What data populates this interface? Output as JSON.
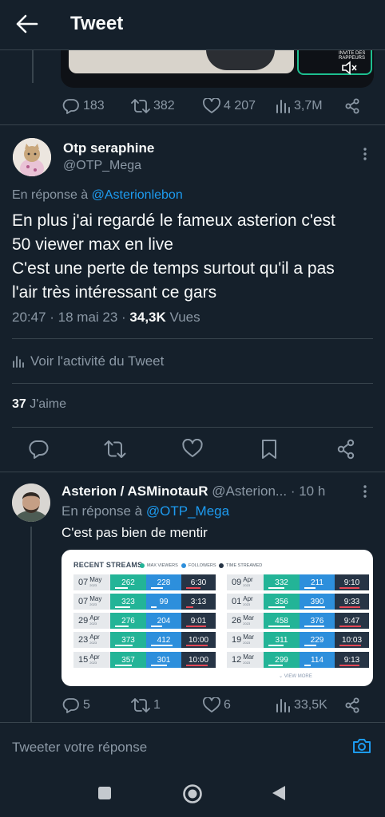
{
  "header": {
    "title": "Tweet"
  },
  "prev_tweet": {
    "media_label": "INVITE DES RAPPEURS",
    "stats": {
      "replies": "183",
      "retweets": "382",
      "likes": "4 207",
      "views": "3,7M"
    }
  },
  "main_tweet": {
    "name": "Otp seraphine",
    "handle": "@OTP_Mega",
    "reply_prefix": "En réponse à",
    "reply_to": "@Asterionlebon",
    "lines": [
      "En plus j'ai regardé le fameux asterion c'est",
      "50 viewer max en live",
      "C'est une perte de temps surtout qu'il a pas",
      "l'air très intéressant ce gars"
    ],
    "time": "20:47 · 18 mai 23 · ",
    "views_count": "34,3K",
    "views_label": " Vues",
    "activity": "Voir l'activité du Tweet",
    "likes_count": "37",
    "likes_label": "J'aime"
  },
  "reply_tweet": {
    "name": "Asterion / ASMinotauR",
    "handle": "@Asterion...",
    "time": "· 10 h",
    "reply_prefix": "En réponse à",
    "reply_to": "@OTP_Mega",
    "text": "C'est pas bien de mentir",
    "stats": {
      "replies": "5",
      "retweets": "1",
      "likes": "6",
      "views": "33,5K"
    },
    "card": {
      "title": "RECENT STREAMS",
      "legend": [
        "MAX VIEWERS",
        "FOLLOWERS",
        "TIME STREAMED"
      ],
      "left": [
        {
          "day": "07",
          "month": "May",
          "year": "2023",
          "viewers": "262",
          "followers": "228",
          "time": "6:30"
        },
        {
          "day": "07",
          "month": "May",
          "year": "2023",
          "viewers": "323",
          "followers": "99",
          "time": "3:13"
        },
        {
          "day": "29",
          "month": "Apr",
          "year": "2023",
          "viewers": "276",
          "followers": "204",
          "time": "9:01"
        },
        {
          "day": "23",
          "month": "Apr",
          "year": "2023",
          "viewers": "373",
          "followers": "412",
          "time": "10:00"
        },
        {
          "day": "15",
          "month": "Apr",
          "year": "2023",
          "viewers": "357",
          "followers": "301",
          "time": "10:00"
        }
      ],
      "right": [
        {
          "day": "09",
          "month": "Apr",
          "year": "2023",
          "viewers": "332",
          "followers": "211",
          "time": "9:10"
        },
        {
          "day": "01",
          "month": "Apr",
          "year": "2023",
          "viewers": "356",
          "followers": "390",
          "time": "9:33"
        },
        {
          "day": "26",
          "month": "Mar",
          "year": "2023",
          "viewers": "458",
          "followers": "376",
          "time": "9:47"
        },
        {
          "day": "19",
          "month": "Mar",
          "year": "2023",
          "viewers": "311",
          "followers": "229",
          "time": "10:03"
        },
        {
          "day": "12",
          "month": "Mar",
          "year": "2023",
          "viewers": "299",
          "followers": "114",
          "time": "9:13"
        }
      ],
      "view_more": "VIEW MORE"
    }
  },
  "composer": {
    "placeholder": "Tweeter votre réponse"
  },
  "colors": {
    "background": "#15202b",
    "accent": "#1d9bf0",
    "muted": "#8b98a5",
    "divider": "#38444d"
  },
  "icons": [
    "back-arrow-icon",
    "reply-icon",
    "retweet-icon",
    "like-icon",
    "views-icon",
    "share-icon",
    "more-icon",
    "bookmark-icon",
    "camera-icon",
    "mute-icon"
  ]
}
